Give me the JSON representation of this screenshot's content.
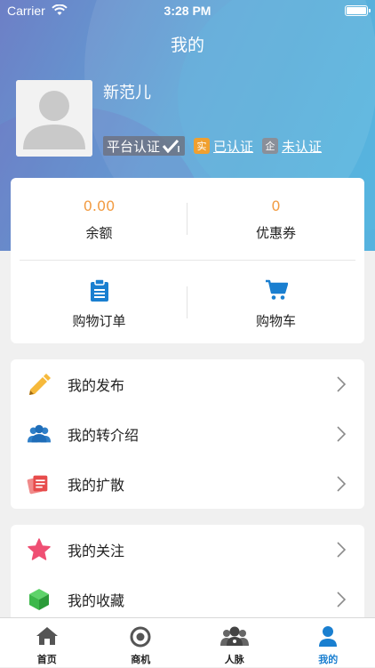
{
  "status_bar": {
    "carrier": "Carrier",
    "time": "3:28 PM"
  },
  "nav": {
    "title": "我的"
  },
  "profile": {
    "name": "新范儿",
    "platform_badge": "平台认证",
    "real_tag": "实",
    "real_status": "已认证",
    "ent_tag": "企",
    "ent_status": "未认证"
  },
  "stats": {
    "balance_value": "0.00",
    "balance_label": "余额",
    "coupon_value": "0",
    "coupon_label": "优惠券"
  },
  "shortcuts": {
    "orders_label": "购物订单",
    "cart_label": "购物车"
  },
  "menu_group_1": [
    {
      "label": "我的发布",
      "icon": "pencil-icon"
    },
    {
      "label": "我的转介绍",
      "icon": "group-icon"
    },
    {
      "label": "我的扩散",
      "icon": "cards-icon"
    }
  ],
  "menu_group_2": [
    {
      "label": "我的关注",
      "icon": "star-icon"
    },
    {
      "label": "我的收藏",
      "icon": "cube-icon"
    }
  ],
  "tabbar": [
    {
      "label": "首页",
      "icon": "home-icon"
    },
    {
      "label": "商机",
      "icon": "target-icon"
    },
    {
      "label": "人脉",
      "icon": "people-icon"
    },
    {
      "label": "我的",
      "icon": "person-icon",
      "active": true
    }
  ],
  "colors": {
    "accent": "#1a7fd0",
    "value_orange": "#f29c43",
    "header_start": "#6d7fc6",
    "header_end": "#55b3df"
  }
}
